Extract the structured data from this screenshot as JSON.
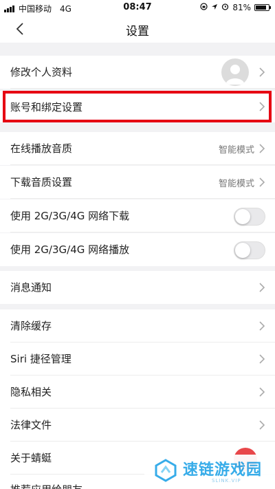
{
  "status_bar": {
    "carrier": "中国移动",
    "network": "4G",
    "time": "08:47",
    "battery_percent": "81%",
    "battery_level": 0.81
  },
  "nav": {
    "title": "设置"
  },
  "groups": {
    "profile": {
      "label": "修改个人资料"
    },
    "account": {
      "label": "账号和绑定设置"
    },
    "playback": {
      "online_label": "在线播放音质",
      "online_value": "智能模式",
      "download_label": "下载音质设置",
      "download_value": "智能模式",
      "net_download_label": "使用 2G/3G/4G 网络下载",
      "net_download_on": false,
      "net_play_label": "使用 2G/3G/4G 网络播放",
      "net_play_on": false
    },
    "notifications": {
      "label": "消息通知"
    },
    "misc": {
      "clear_cache": "清除缓存",
      "siri": "Siri 捷径管理",
      "privacy": "隐私相关",
      "legal": "法律文件",
      "about": "关于蜻蜓",
      "recommend": "推荐应用给朋友"
    }
  },
  "watermark": {
    "text": "速链游戏园",
    "sub": "SLINK.VIP"
  },
  "colors": {
    "highlight": "#e60012",
    "background": "#f2f2f4",
    "watermark": "#2da8e8"
  }
}
